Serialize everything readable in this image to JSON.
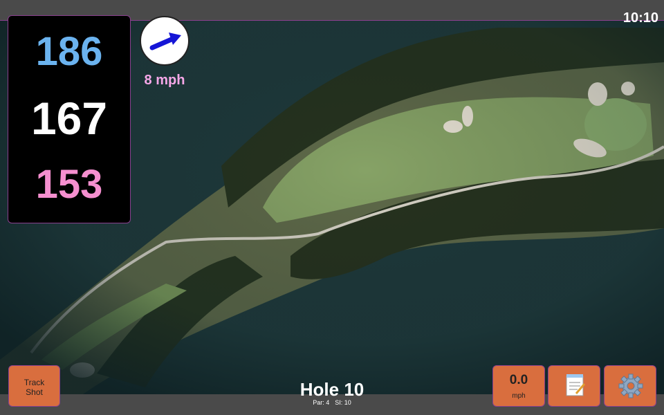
{
  "clock": "10:10",
  "yardages": {
    "back": "186",
    "middle": "167",
    "front": "153"
  },
  "wind": {
    "speed_label": "8 mph",
    "arrow_icon": "wind-direction-arrow-icon"
  },
  "buttons": {
    "track_shot_line1": "Track",
    "track_shot_line2": "Shot",
    "wind_value": "0.0",
    "wind_unit": "mph",
    "notes_icon": "notepad-icon",
    "settings_icon": "gear-icon"
  },
  "hole": {
    "title": "Hole 10",
    "par": "Par: 4",
    "si": "SI: 10"
  },
  "colors": {
    "accent_border": "#8a3f8f",
    "button": "#d96e3e",
    "back": "#6bb3ef",
    "front": "#f58fcf"
  }
}
